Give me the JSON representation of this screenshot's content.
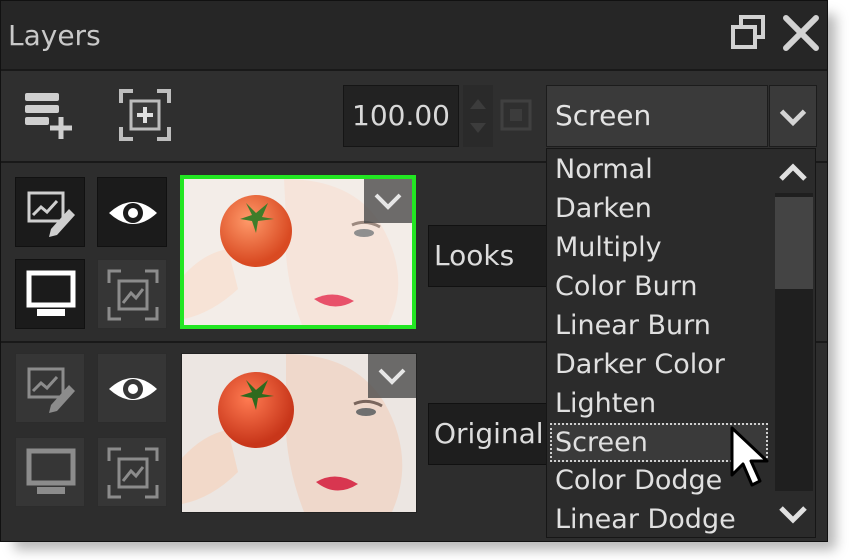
{
  "panel": {
    "title": "Layers"
  },
  "toolbar": {
    "opacity": "100.00",
    "blend_mode": "Screen"
  },
  "layers": [
    {
      "name": "Looks",
      "selected": true,
      "visible": true
    },
    {
      "name": "Original",
      "selected": false,
      "visible": true
    }
  ],
  "blend_menu": {
    "options": [
      "Normal",
      "Darken",
      "Multiply",
      "Color Burn",
      "Linear Burn",
      "Darker Color",
      "Lighten",
      "Screen",
      "Color Dodge",
      "Linear Dodge"
    ],
    "selected": "Screen"
  },
  "colors": {
    "selection_border": "#22e622",
    "panel_bg": "#2b2b2b"
  }
}
